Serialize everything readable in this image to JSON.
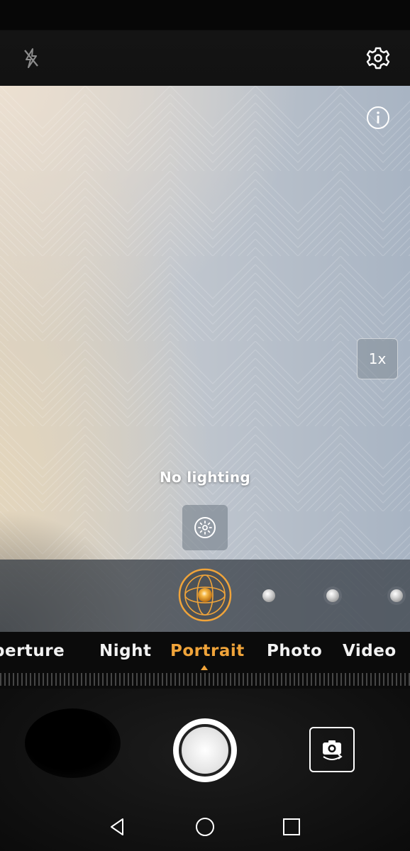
{
  "top_bar": {
    "flash_icon": "flash-off-icon",
    "settings_icon": "gear-icon"
  },
  "viewfinder": {
    "info_icon": "info-icon",
    "zoom_label": "1x",
    "lighting_label": "No lighting",
    "lighting_icon": "lighting-effect-icon",
    "effect_selected_icon": "portrait-lighting-icon"
  },
  "modes": [
    {
      "label": "Aperture",
      "visible_text": "perture"
    },
    {
      "label": "Night"
    },
    {
      "label": "Portrait",
      "active": true
    },
    {
      "label": "Photo"
    },
    {
      "label": "Video"
    }
  ],
  "bottom": {
    "gallery_icon": "gallery-thumbnail",
    "shutter_icon": "shutter-icon",
    "switch_camera_icon": "switch-camera-icon"
  },
  "nav_bar": {
    "back_icon": "back-icon",
    "home_icon": "home-icon",
    "recents_icon": "recents-icon"
  },
  "colors": {
    "accent": "#f0a43a",
    "background": "#0a0a0a"
  }
}
